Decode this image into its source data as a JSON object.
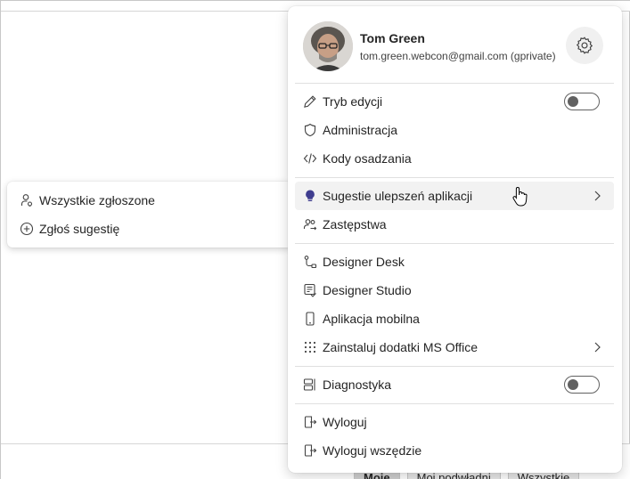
{
  "user": {
    "name": "Tom Green",
    "email": "tom.green.webcon@gmail.com (gprivate)"
  },
  "menu": {
    "group1": [
      {
        "label": "Tryb edycji",
        "icon": "pencil-icon",
        "toggle": false
      },
      {
        "label": "Administracja",
        "icon": "shield-icon"
      },
      {
        "label": "Kody osadzania",
        "icon": "code-icon"
      }
    ],
    "group2": [
      {
        "label": "Sugestie ulepszeń aplikacji",
        "icon": "lightbulb-icon",
        "has_submenu": true,
        "hovered": true
      },
      {
        "label": "Zastępstwa",
        "icon": "people-swap-icon"
      }
    ],
    "group3": [
      {
        "label": "Designer Desk",
        "icon": "flow-icon"
      },
      {
        "label": "Designer Studio",
        "icon": "document-icon"
      },
      {
        "label": "Aplikacja mobilna",
        "icon": "phone-icon"
      },
      {
        "label": "Zainstaluj dodatki MS Office",
        "icon": "grid-dots-icon",
        "has_submenu": true
      }
    ],
    "group4": [
      {
        "label": "Diagnostyka",
        "icon": "diagnostics-icon",
        "toggle": false
      }
    ],
    "group5": [
      {
        "label": "Wyloguj",
        "icon": "sign-out-icon"
      },
      {
        "label": "Wyloguj wszędzie",
        "icon": "sign-out-all-icon"
      }
    ]
  },
  "submenu": [
    {
      "label": "Wszystkie zgłoszone",
      "icon": "person-list-icon"
    },
    {
      "label": "Zgłoś sugestię",
      "icon": "add-circle-icon"
    }
  ],
  "tabs": [
    "Moje",
    "Moi podwładni",
    "Wszystkie"
  ],
  "colors": {
    "accent_bulb": "#3f3d8f",
    "toggle": "#616161"
  }
}
